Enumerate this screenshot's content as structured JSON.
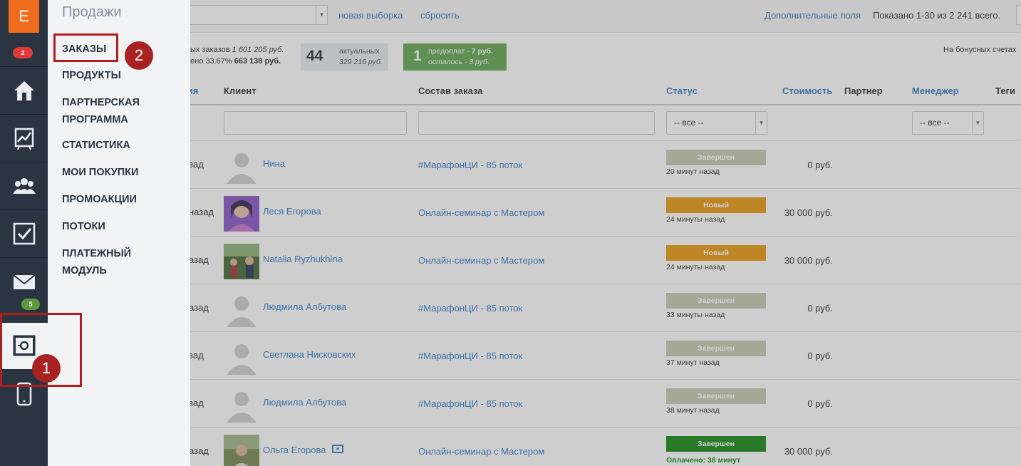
{
  "sidebar": {
    "logo": "E",
    "notif_badge": "2",
    "mail_badge": "5",
    "items": [
      {
        "icon": "home-icon"
      },
      {
        "icon": "chart-icon"
      },
      {
        "icon": "users-icon"
      },
      {
        "icon": "tasks-icon"
      },
      {
        "icon": "mail-icon"
      },
      {
        "icon": "sales-safe-icon"
      },
      {
        "icon": "mobile-icon"
      }
    ]
  },
  "menu": {
    "title": "Продажи",
    "items": [
      "ЗАКАЗЫ",
      "ПРОДУКТЫ",
      "ПАРТНЕРСКАЯ ПРОГРАММА",
      "СТАТИСТИКА",
      "МОИ ПОКУПКИ",
      "ПРОМОАКЦИИ",
      "ПОТОКИ",
      "ПЛАТЕЖНЫЙ МОДУЛЬ"
    ]
  },
  "topbar": {
    "new_selection": "новая выборка",
    "reset": "сбросить",
    "extra_fields": "Дополнительные поля",
    "shown": "Показано 1-30 из 2 241 всего."
  },
  "stats": {
    "line1_text": "ых заказов ",
    "line1_value": "1 601 205 руб.",
    "line2_text": "ено 33.67% ",
    "line2_value": "663 138 руб.",
    "actual_count": "44",
    "actual_label": "актуальных",
    "actual_sum": "329 216 руб.",
    "prepay_count": "1",
    "prepay_label": "предоплат - ",
    "prepay_value": "7 руб.",
    "remaining_label": "осталось - ",
    "remaining_value": "3 руб.",
    "bonus": "На бонусных счетах"
  },
  "table": {
    "headers": {
      "date": "ния",
      "client": "Клиент",
      "order": "Состав заказа",
      "status": "Статус",
      "cost": "Стоимость",
      "partner": "Партнер",
      "manager": "Менеджер",
      "tags": "Теги"
    },
    "filter_all": "-- все --",
    "rows": [
      {
        "date": "зад",
        "name": "Нина",
        "offer": "#МарафонЦИ - 85 поток",
        "status": "Завершен",
        "status_color": "#c8cbb3",
        "status_sub": "20 минут назад",
        "price": "0 руб.",
        "avatar": "default"
      },
      {
        "date": "назад",
        "name": "Леся Егорова",
        "offer": "Онлайн-семинар с Мастером",
        "status": "Новый",
        "status_color": "#e89a12",
        "status_sub": "24 минуты назад",
        "price": "30 000 руб.",
        "avatar": "photo1"
      },
      {
        "date": "азад",
        "name": "Natalia Ryzhukhina",
        "offer": "Онлайн-семинар с Мастером",
        "status": "Новый",
        "status_color": "#e89a12",
        "status_sub": "24 минуты назад",
        "price": "30 000 руб.",
        "avatar": "photo2"
      },
      {
        "date": "азад",
        "name": "Людмила Албутова",
        "offer": "#МарафонЦИ - 85 поток",
        "status": "Завершен",
        "status_color": "#c8cbb3",
        "status_sub": "33 минуты назад",
        "price": "0 руб.",
        "avatar": "default"
      },
      {
        "date": "зад",
        "name": "Светлана Нисковских",
        "offer": "#МарафонЦИ - 85 поток",
        "status": "Завершен",
        "status_color": "#c8cbb3",
        "status_sub": "37 минут назад",
        "price": "0 руб.",
        "avatar": "default"
      },
      {
        "date": "зад",
        "name": "Людмила Албутова",
        "offer": "#МарафонЦИ - 85 поток",
        "status": "Завершен",
        "status_color": "#c8cbb3",
        "status_sub": "38 минут назад",
        "price": "0 руб.",
        "avatar": "default"
      },
      {
        "date": "азад",
        "name": "Ольга Егорова",
        "offer": "Онлайн-семинар с Мастером",
        "status": "Завершен",
        "status_color": "#1a8a1a",
        "status_sub": "Оплачено: 38 минут",
        "price": "30 000 руб.",
        "avatar": "photo3"
      }
    ]
  },
  "callouts": [
    "1",
    "2"
  ],
  "colors": {
    "sidebar_bg": "#2b3542",
    "accent_orange": "#f06c1e",
    "link_blue": "#3a7fc4",
    "callout_red": "#b01e1e"
  }
}
